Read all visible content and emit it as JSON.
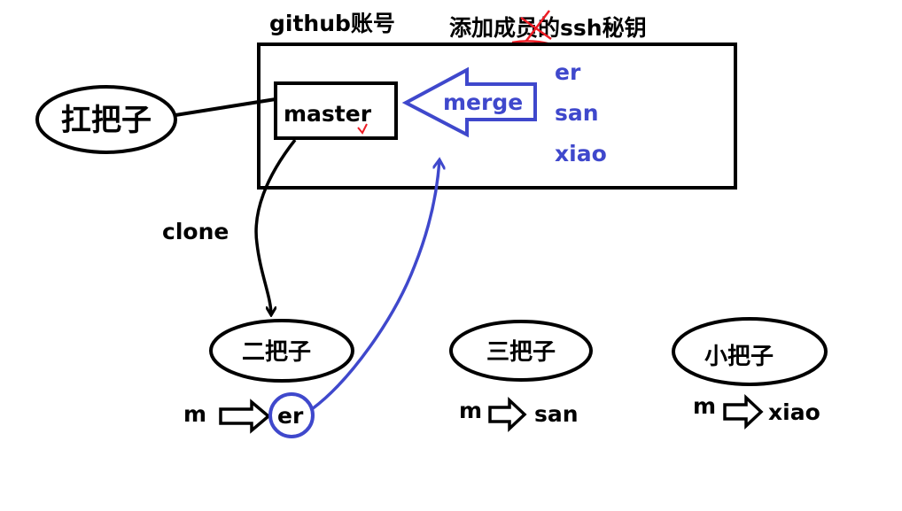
{
  "github_label": "github账号",
  "ssh_label_prefix": "添加",
  "ssh_label_struck": "成员",
  "ssh_label_suffix": "的ssh秘钥",
  "main_branch": "master",
  "merge_label": "merge",
  "clone_label": "clone",
  "owner": "扛把子",
  "members": [
    {
      "name": "二把子",
      "local_branch": "m",
      "remote_branch": "er"
    },
    {
      "name": "三把子",
      "local_branch": "m",
      "remote_branch": "san"
    },
    {
      "name": "小把子",
      "local_branch": "m",
      "remote_branch": "xiao"
    }
  ],
  "ssh_keys": [
    "er",
    "san",
    "xiao"
  ],
  "colors": {
    "ink": "#000000",
    "accent": "#3f48cc",
    "strike": "#ed1c24"
  }
}
